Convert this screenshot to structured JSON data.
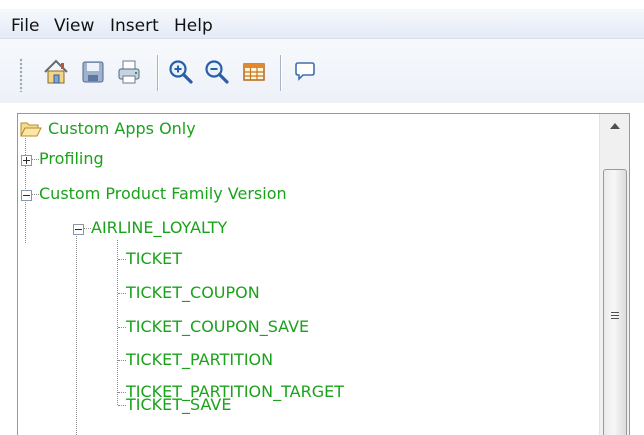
{
  "menu": [
    "File",
    "View",
    "Insert",
    "Help"
  ],
  "toolbar": {
    "buttons": [
      "home-icon",
      "save-icon",
      "print-icon",
      "zoom-in-icon",
      "zoom-out-icon",
      "table-icon",
      "comment-icon"
    ]
  },
  "tree": {
    "root": "Custom Apps Only",
    "profiling": "Profiling",
    "family": "Custom Product Family Version",
    "schema": "AIRLINE_LOYALTY",
    "tables": [
      "TICKET",
      "TICKET_COUPON",
      "TICKET_COUPON_SAVE",
      "TICKET_PARTITION",
      "TICKET_PARTITION_TARGET",
      "TICKET_SAVE"
    ]
  },
  "colors": {
    "tree_text": "#1aa31a",
    "menu_bg": "#eef3fa"
  }
}
